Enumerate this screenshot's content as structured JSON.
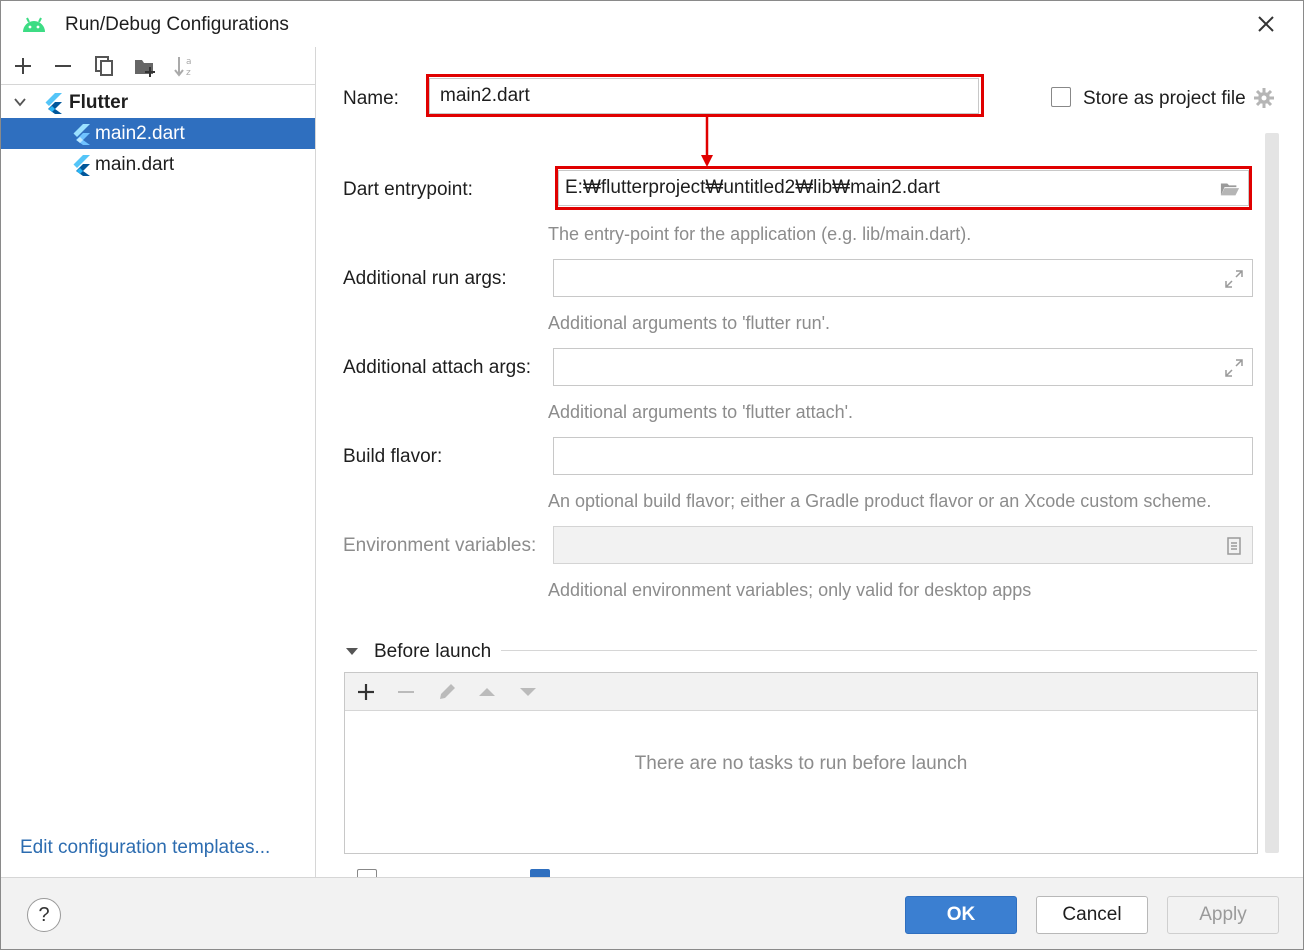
{
  "window": {
    "title": "Run/Debug Configurations",
    "close_icon": "close-icon",
    "app_icon": "android-icon"
  },
  "left_panel": {
    "toolbar": [
      "add-icon",
      "remove-icon",
      "copy-icon",
      "new-folder-icon",
      "sort-icon"
    ],
    "tree": {
      "group_label": "Flutter",
      "items": [
        {
          "label": "main2.dart",
          "selected": true
        },
        {
          "label": "main.dart",
          "selected": false
        }
      ]
    },
    "edit_templates_link": "Edit configuration templates..."
  },
  "form": {
    "name_label": "Name:",
    "name_value": "main2.dart",
    "store_as_project_file_label": "Store as project file",
    "store_as_project_file_checked": false,
    "dart_entrypoint_label": "Dart entrypoint:",
    "dart_entrypoint_value": "E:₩flutterproject₩untitled2₩lib₩main2.dart",
    "dart_entrypoint_hint": "The entry-point for the application (e.g. lib/main.dart).",
    "run_args_label": "Additional run args:",
    "run_args_value": "",
    "run_args_hint": "Additional arguments to 'flutter run'.",
    "attach_args_label": "Additional attach args:",
    "attach_args_value": "",
    "attach_args_hint": "Additional arguments to 'flutter attach'.",
    "build_flavor_label": "Build flavor:",
    "build_flavor_value": "",
    "build_flavor_hint": "An optional build flavor; either a Gradle product flavor or an Xcode custom scheme.",
    "env_vars_label": "Environment variables:",
    "env_vars_value": "",
    "env_vars_hint": "Additional environment variables; only valid for desktop apps"
  },
  "before_launch": {
    "title": "Before launch",
    "toolbar": [
      "add-icon",
      "remove-icon",
      "edit-icon",
      "move-up-icon",
      "move-down-icon"
    ],
    "empty_text": "There are no tasks to run before launch"
  },
  "buttons": {
    "help": "?",
    "ok": "OK",
    "cancel": "Cancel",
    "apply": "Apply"
  },
  "colors": {
    "selection": "#2f6fbf",
    "highlight_box": "#e00000",
    "link": "#2c6cb0",
    "primary_button": "#3b7fd1"
  }
}
